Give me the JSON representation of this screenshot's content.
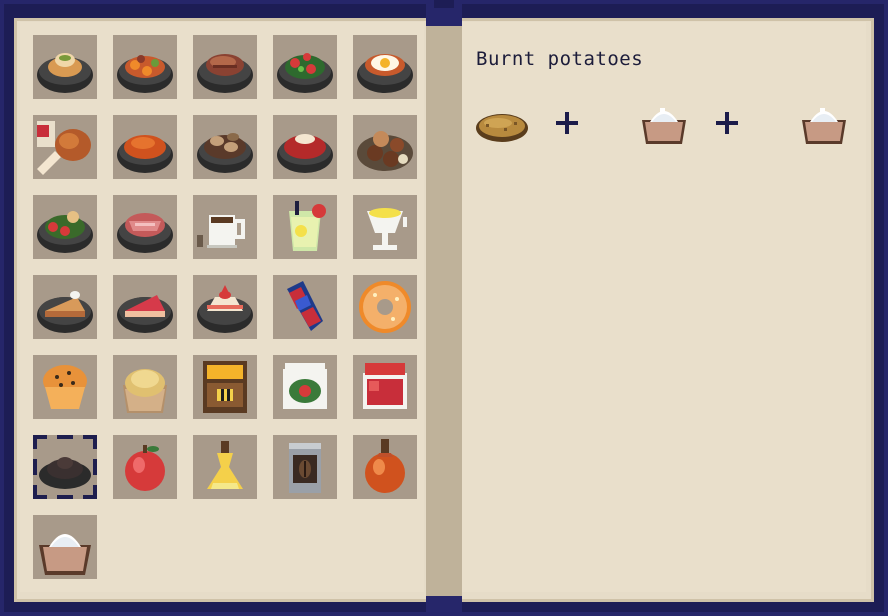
{
  "recipe": {
    "title": "Burnt potatoes",
    "ingredients": [
      "potato-icon",
      "salt-bowl-icon",
      "salt-bowl-icon"
    ]
  },
  "inventory": {
    "items": [
      "bowl-stuffed-icon",
      "bowl-carrot-stew-icon",
      "bowl-meat-icon",
      "bowl-salad-icon",
      "bowl-fried-egg-icon",
      "chicken-leg-icon",
      "bowl-tomato-soup-icon",
      "bowl-mushroom-icon",
      "bowl-berry-soup-icon",
      "plate-meatballs-icon",
      "bowl-mixed-salad-icon",
      "bowl-ham-icon",
      "coffee-mug-icon",
      "lemonade-glass-icon",
      "milkshake-glass-icon",
      "pie-slice-icon",
      "cherry-pie-slice-icon",
      "strawberry-cake-slice-icon",
      "sausage-skewer-icon",
      "donut-icon",
      "muffin-icon",
      "sack-of-flour-icon",
      "honey-jar-icon",
      "pickle-jar-icon",
      "jam-jar-icon",
      "burnt-food-icon",
      "apple-icon",
      "oil-bottle-icon",
      "coffee-can-icon",
      "sauce-bottle-icon",
      "salt-bowl-icon"
    ],
    "selected_index": 25
  },
  "colors": {
    "cover": "#26266a",
    "page": "#e9dfcb",
    "slot": "#a89a8a",
    "text": "#1c1c3a"
  }
}
